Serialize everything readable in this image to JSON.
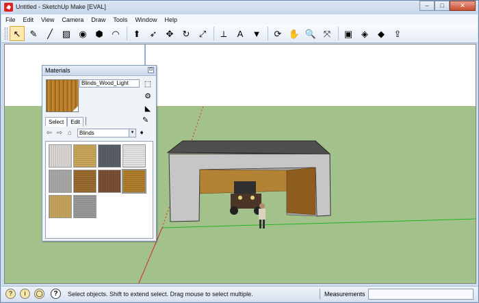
{
  "window": {
    "title": "Untitled - SketchUp Make [EVAL]",
    "min": "–",
    "max": "□",
    "close": "✕"
  },
  "menu": [
    "File",
    "Edit",
    "View",
    "Camera",
    "Draw",
    "Tools",
    "Window",
    "Help"
  ],
  "toolbar": {
    "tools": [
      {
        "name": "select-tool",
        "icon": "↖"
      },
      {
        "name": "eraser-tool",
        "icon": "✎"
      },
      {
        "name": "line-tool",
        "icon": "╱"
      },
      {
        "name": "rectangle-tool",
        "icon": "▨"
      },
      {
        "name": "circle-tool",
        "icon": "◉"
      },
      {
        "name": "polygon-tool",
        "icon": "⬢"
      },
      {
        "name": "arc-tool",
        "icon": "◠"
      },
      {
        "name": "push-pull-tool",
        "icon": "⬆"
      },
      {
        "name": "follow-me-tool",
        "icon": "➶"
      },
      {
        "name": "move-tool",
        "icon": "✥"
      },
      {
        "name": "rotate-tool",
        "icon": "↻"
      },
      {
        "name": "scale-tool",
        "icon": "⤢"
      },
      {
        "name": "tape-measure-tool",
        "icon": "⟂"
      },
      {
        "name": "text-tool",
        "icon": "A"
      },
      {
        "name": "paint-bucket-tool",
        "icon": "▼"
      },
      {
        "name": "orbit-tool",
        "icon": "⟳"
      },
      {
        "name": "pan-tool",
        "icon": "✋"
      },
      {
        "name": "zoom-tool",
        "icon": "🔍"
      },
      {
        "name": "zoom-extents-tool",
        "icon": "⤧"
      },
      {
        "name": "warehouse-tool",
        "icon": "▣"
      },
      {
        "name": "components-tool",
        "icon": "◈"
      },
      {
        "name": "extensions-tool",
        "icon": "◆"
      },
      {
        "name": "share-tool",
        "icon": "⇪"
      }
    ]
  },
  "materials": {
    "title": "Materials",
    "close": "⊡",
    "material_name": "Blinds_Wood_Light",
    "tabs": [
      "Select",
      "Edit"
    ],
    "collection": "Blinds",
    "swatches": [
      {
        "name": "blinds-light-gray",
        "color": "#d9d6d4"
      },
      {
        "name": "blinds-tan",
        "color": "#c9a65a"
      },
      {
        "name": "blinds-dark-slate",
        "color": "#5a5f66"
      },
      {
        "name": "blinds-white",
        "color": "#e4e4e4"
      },
      {
        "name": "blinds-gray-wood",
        "color": "#a9a9a9"
      },
      {
        "name": "blinds-brown-wood",
        "color": "#9c6b30"
      },
      {
        "name": "blinds-dark-wood",
        "color": "#7a5032"
      },
      {
        "name": "blinds-wood-light",
        "color": "#b07d2a"
      },
      {
        "name": "blinds-pale-wood",
        "color": "#c5a45c"
      },
      {
        "name": "blinds-metal",
        "color": "#9a9a9a"
      }
    ]
  },
  "status": {
    "message": "Select objects. Shift to extend select. Drag mouse to select multiple.",
    "measurements_label": "Measurements",
    "measurements_value": ""
  },
  "colors": {
    "sky": "#ffffff",
    "ground": "#a3c28b",
    "wall": "#c9c9c9",
    "roof": "#505050",
    "wood": "#b38235"
  }
}
